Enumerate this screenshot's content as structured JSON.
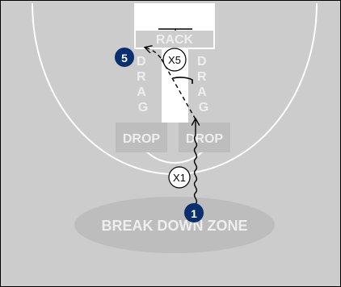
{
  "court": {
    "floor_color": "#cccccc",
    "line_color": "#ffffff",
    "lane_color": "#ffffff",
    "border_color": "#000000"
  },
  "zones": {
    "rack_label": "RACK",
    "drag_left_label": "DRAG",
    "drag_right_label": "DRAG",
    "drop_left_label": "DROP",
    "drop_right_label": "DROP",
    "break_down_label": "BREAK DOWN ZONE",
    "zone_fill": "#bdbdbd",
    "zone_text_color": "#eeeeee"
  },
  "players": {
    "offense_1": "1",
    "offense_5": "5",
    "defense_1": "X1",
    "defense_5": "X5",
    "offense_color": "#0b2e6e",
    "defense_fill": "#ffffff"
  }
}
